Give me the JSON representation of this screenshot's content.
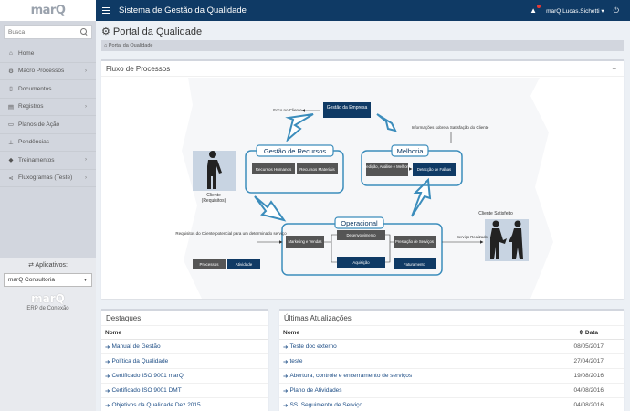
{
  "logo": "marQ",
  "sidebar": {
    "search_placeholder": "Busca",
    "items": [
      {
        "label": "Home",
        "icon": "home-icon",
        "glyph": "⌂",
        "chev": ""
      },
      {
        "label": "Macro Processos",
        "icon": "sitemap-icon",
        "glyph": "⚙",
        "chev": "›"
      },
      {
        "label": "Documentos",
        "icon": "file-icon",
        "glyph": "▯",
        "chev": ""
      },
      {
        "label": "Registros",
        "icon": "copy-icon",
        "glyph": "▤",
        "chev": "›"
      },
      {
        "label": "Planos de Ação",
        "icon": "clipboard-icon",
        "glyph": "▭",
        "chev": ""
      },
      {
        "label": "Pendências",
        "icon": "thumbtack-icon",
        "glyph": "⊥",
        "chev": ""
      },
      {
        "label": "Treinamentos",
        "icon": "graduation-icon",
        "glyph": "◆",
        "chev": "›"
      },
      {
        "label": "Fluxogramas (Teste)",
        "icon": "share-icon",
        "glyph": "⋖",
        "chev": "›"
      }
    ],
    "apps_label": "⇄ Aplicativos:",
    "apps_selected": "marQ Consultoria",
    "sub_logo": "marQ",
    "sub_logo_caption": "ERP de Conexão"
  },
  "header": {
    "title": "Sistema de Gestão da Qualidade",
    "user": "marQ.Lucas.Sichetti ▾"
  },
  "page": {
    "title": "Portal da Qualidade",
    "breadcrumb": "⌂ Portal da Qualidade"
  },
  "process_box": {
    "title": "Fluxo de Processos",
    "collapse": "−",
    "diagram": {
      "gestao_empresa": "Gestão da Empresa",
      "foco_cliente": "Foco no Cliente",
      "gestao_recursos": "Gestão de Recursos",
      "recursos_humanos": "Recursos Humanos",
      "recursos_materiais": "Recursos Materiais",
      "melhoria": "Melhoria",
      "medicao": "Medição, Análise e Melhoria",
      "deteccao": "Detecção de Falhas",
      "informacoes": "Informações sobre a Satisfação do Cliente",
      "cliente": "Cliente",
      "requisitos": "(Requisitos)",
      "operacional": "Operacional",
      "req_cliente": "Requisitos do Cliente potencial para um determinado serviço",
      "marketing": "Marketing e Vendas",
      "desenvolvimento": "Desenvolvimento",
      "prestacao": "Prestação de Serviços",
      "aquisicao": "Aquisição",
      "faturamento": "Faturamento",
      "processos": "Processos",
      "atividade": "Atividade",
      "cliente_satisfeito": "Cliente Satisfeito",
      "servico_realizado": "Serviço Realizado"
    }
  },
  "destaques": {
    "title": "Destaques",
    "col_nome": "Nome",
    "items": [
      "Manual de Gestão",
      "Política da Qualidade",
      "Certificado ISO 9001 marQ",
      "Certificado ISO 9001 DMT",
      "Objetivos da Qualidade Dez 2015"
    ]
  },
  "atualizacoes": {
    "title": "Últimas Atualizações",
    "col_nome": "Nome",
    "col_data": "⇕ Data",
    "rows": [
      {
        "name": "Teste doc externo",
        "date": "08/05/2017"
      },
      {
        "name": "teste",
        "date": "27/04/2017"
      },
      {
        "name": "Abertura, controle e encerramento de serviços",
        "date": "19/08/2016"
      },
      {
        "name": "Plano de Atividades",
        "date": "04/08/2016"
      },
      {
        "name": "SS. Seguimento de Serviço",
        "date": "04/08/2016"
      }
    ]
  },
  "colors": {
    "header": "#0f3a65",
    "dark_box": "#0f3a65",
    "gray_box": "#555555",
    "cycle_border": "#3c8dbc"
  }
}
